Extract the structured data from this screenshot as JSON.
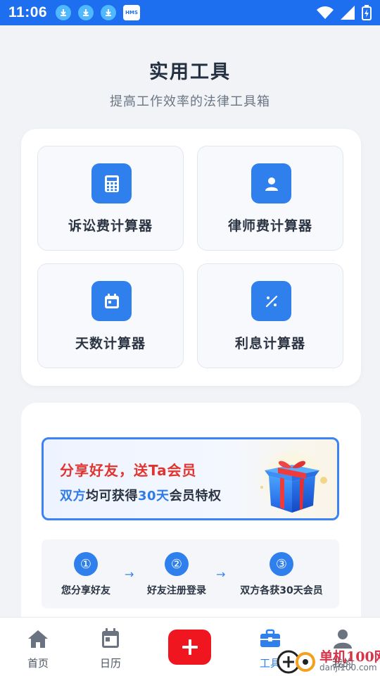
{
  "status_bar": {
    "time": "11:06",
    "notif_icons": [
      "download-icon",
      "download-icon",
      "download-icon"
    ],
    "hms_label": "HMS"
  },
  "header": {
    "title": "实用工具",
    "subtitle": "提高工作效率的法律工具箱"
  },
  "tools": [
    {
      "label": "诉讼费计算器",
      "icon": "calculator-icon"
    },
    {
      "label": "律师费计算器",
      "icon": "person-icon"
    },
    {
      "label": "天数计算器",
      "icon": "calendar-icon"
    },
    {
      "label": "利息计算器",
      "icon": "percent-icon"
    }
  ],
  "share": {
    "title": "分享好友，送Ta会员",
    "sub_part1": "双方",
    "sub_part2": "均可获得",
    "sub_part3": "30天",
    "sub_part4": "会员特权"
  },
  "steps": [
    {
      "num": "①",
      "label": "您分享好友"
    },
    {
      "num": "②",
      "label": "好友注册登录"
    },
    {
      "num": "③",
      "label": "双方各获30天会员"
    }
  ],
  "bottom_nav": {
    "home": "首页",
    "calendar": "日历",
    "tools": "工具",
    "mine": "我的"
  },
  "colors": {
    "accent": "#2f80ed",
    "status_bar": "#1e6ff0",
    "add_button": "#f01620",
    "banner_title": "#e0342f"
  },
  "watermark": {
    "text": "单机100网",
    "url": "danji100.com"
  }
}
